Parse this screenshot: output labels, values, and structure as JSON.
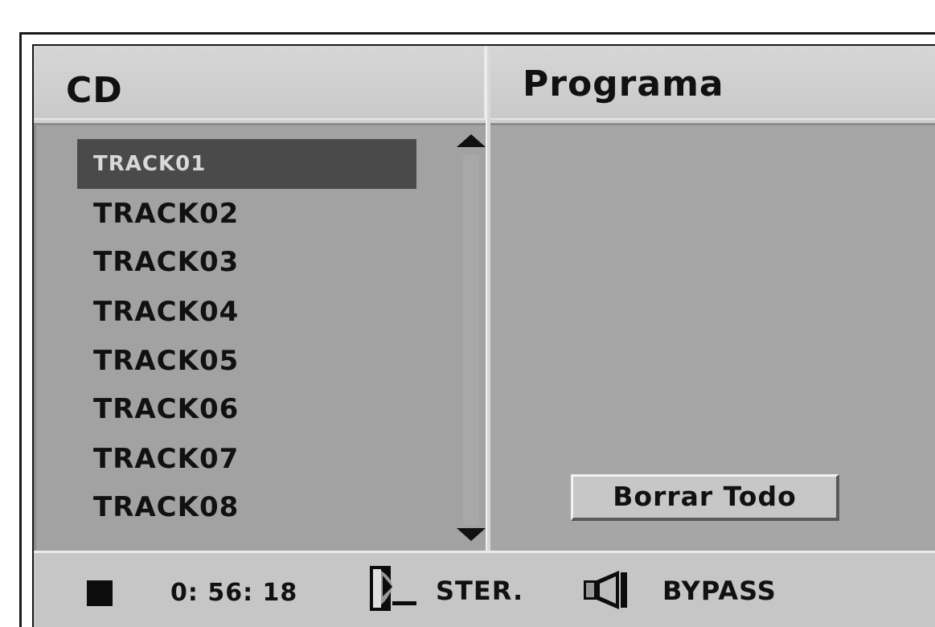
{
  "header": {
    "cd_title": "CD",
    "program_title": "Programa"
  },
  "cd_list": {
    "tracks": [
      {
        "label": "TRACK01",
        "selected": true
      },
      {
        "label": "TRACK02",
        "selected": false
      },
      {
        "label": "TRACK03",
        "selected": false
      },
      {
        "label": "TRACK04",
        "selected": false
      },
      {
        "label": "TRACK05",
        "selected": false
      },
      {
        "label": "TRACK06",
        "selected": false
      },
      {
        "label": "TRACK07",
        "selected": false
      },
      {
        "label": "TRACK08",
        "selected": false
      }
    ]
  },
  "program": {
    "clear_all_label": "Borrar Todo"
  },
  "status": {
    "playback_state_icon": "stop-icon",
    "time": "0: 56: 18",
    "audio_icon": "audio-channel-icon",
    "audio_mode": "STER.",
    "speaker_icon": "speaker-icon",
    "sound_mode": "BYPASS"
  },
  "colors": {
    "panel": "#a2a2a2",
    "header": "#d0d0d0",
    "selection": "#4a4a4a",
    "text": "#111111"
  }
}
